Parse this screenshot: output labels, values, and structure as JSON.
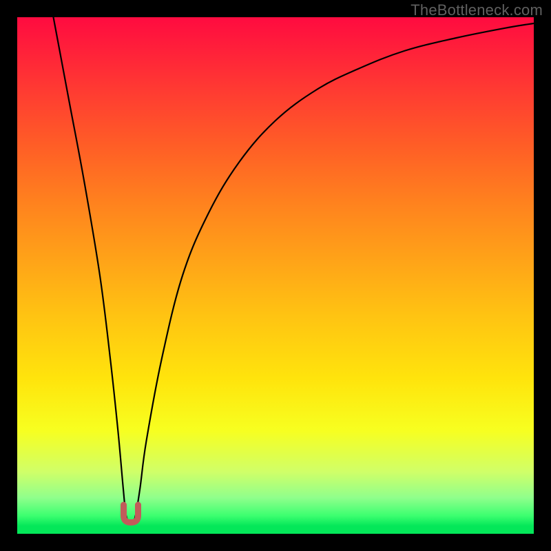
{
  "watermark": "TheBottleneck.com",
  "chart_data": {
    "type": "line",
    "title": "",
    "xlabel": "",
    "ylabel": "",
    "ylim": [
      0,
      100
    ],
    "xlim": [
      0,
      100
    ],
    "series": [
      {
        "name": "bottleneck-curve",
        "x": [
          7,
          10,
          13,
          16,
          18,
          19.5,
          20.5,
          21,
          21.5,
          22,
          22.5,
          23,
          23.8,
          25,
          28,
          32,
          37,
          43,
          50,
          58,
          66,
          75,
          85,
          95,
          100
        ],
        "values": [
          100,
          84,
          68,
          50,
          34,
          20,
          9,
          4,
          2.3,
          2,
          2.3,
          4,
          9,
          18,
          34,
          50,
          62,
          72,
          80,
          86,
          90,
          93.5,
          96,
          98,
          98.8
        ]
      }
    ],
    "marker": {
      "name": "optimal-range",
      "x": 22,
      "y": 2.2,
      "width_pct": 2.8,
      "height_pct": 3.4,
      "color": "#c15b5a"
    },
    "background_gradient": {
      "top": "#ff0b40",
      "mid": "#ffe40c",
      "bottom": "#04e759"
    }
  }
}
